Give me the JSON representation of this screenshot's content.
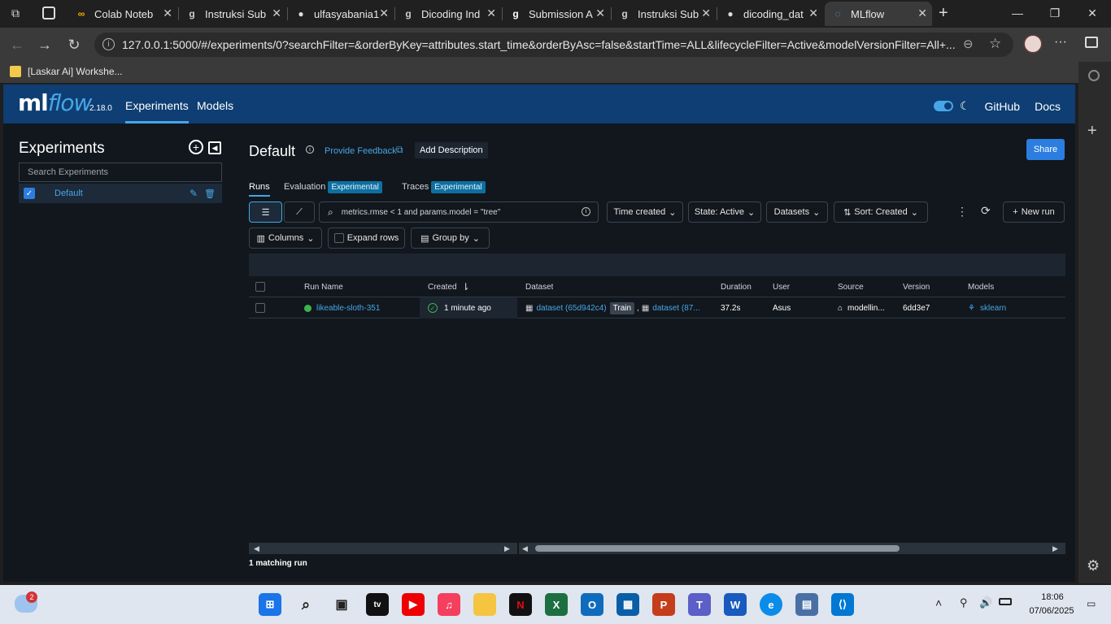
{
  "browser": {
    "tabs": [
      {
        "label": "Colab Noteb",
        "icon": "colab-icon"
      },
      {
        "label": "Instruksi Sub",
        "icon": "dicoding-icon"
      },
      {
        "label": "ulfasyabania1",
        "icon": "github-icon"
      },
      {
        "label": "Dicoding Ind",
        "icon": "dicoding-icon"
      },
      {
        "label": "Submission A",
        "icon": "dicoding-icon"
      },
      {
        "label": "Instruksi Sub",
        "icon": "dicoding-icon"
      },
      {
        "label": "dicoding_dat",
        "icon": "github-icon"
      },
      {
        "label": "MLflow",
        "icon": "mlflow-icon"
      }
    ],
    "url": "127.0.0.1:5000/#/experiments/0?searchFilter=&orderByKey=attributes.start_time&orderByAsc=false&startTime=ALL&lifecycleFilter=Active&modelVersionFilter=All+...",
    "bookmark": "[Laskar Ai] Workshe..."
  },
  "header": {
    "logo_ml": "ml",
    "logo_flow": "flow",
    "version": "2.18.0",
    "nav": [
      "Experiments",
      "Models"
    ],
    "github": "GitHub",
    "docs": "Docs"
  },
  "sidebar": {
    "title": "Experiments",
    "search_placeholder": "Search Experiments",
    "items": [
      {
        "name": "Default"
      }
    ]
  },
  "main": {
    "title": "Default",
    "feedback": "Provide Feedback",
    "add_description": "Add Description",
    "share": "Share",
    "tabs": {
      "runs": "Runs",
      "evaluation": "Evaluation",
      "evaluation_tag": "Experimental",
      "traces": "Traces",
      "traces_tag": "Experimental"
    },
    "search_value": "metrics.rmse < 1 and params.model = \"tree\"",
    "filters": {
      "time": "Time created",
      "state": "State: Active",
      "datasets": "Datasets",
      "sort": "Sort: Created",
      "new_run": "New run",
      "columns": "Columns",
      "expand": "Expand rows",
      "group": "Group by"
    },
    "table": {
      "headers": [
        "Run Name",
        "Created",
        "Dataset",
        "Duration",
        "User",
        "Source",
        "Version",
        "Models"
      ],
      "rows": [
        {
          "run_name": "likeable-sloth-351",
          "created": "1 minute ago",
          "dataset1": "dataset (65d942c4)",
          "dataset_tag": "Train",
          "dataset2": "dataset (87...",
          "duration": "37.2s",
          "user": "Asus",
          "source": "modellin...",
          "version": "6dd3e7",
          "model": "sklearn"
        }
      ]
    },
    "matching": "1 matching run"
  },
  "taskbar": {
    "weather_badge": "2",
    "time": "18:06",
    "date": "07/06/2025"
  }
}
